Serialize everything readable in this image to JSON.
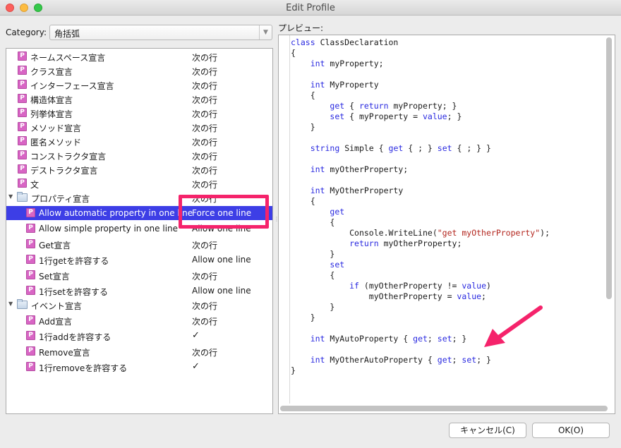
{
  "window": {
    "title": "Edit Profile"
  },
  "category": {
    "label": "Category:",
    "value": "角括弧"
  },
  "tree": {
    "rows": [
      {
        "icon": "p",
        "label": "ネームスペース宣言",
        "value": "次の行"
      },
      {
        "icon": "p",
        "label": "クラス宣言",
        "value": "次の行"
      },
      {
        "icon": "p",
        "label": "インターフェース宣言",
        "value": "次の行"
      },
      {
        "icon": "p",
        "label": "構造体宣言",
        "value": "次の行"
      },
      {
        "icon": "p",
        "label": "列挙体宣言",
        "value": "次の行"
      },
      {
        "icon": "p",
        "label": "メソッド宣言",
        "value": "次の行"
      },
      {
        "icon": "p",
        "label": "匿名メソッド",
        "value": "次の行"
      },
      {
        "icon": "p",
        "label": "コンストラクタ宣言",
        "value": "次の行"
      },
      {
        "icon": "p",
        "label": "デストラクタ宣言",
        "value": "次の行"
      },
      {
        "icon": "p",
        "label": "文",
        "value": "次の行"
      },
      {
        "icon": "folder",
        "label": "プロパティ宣言",
        "value": "次の行"
      },
      {
        "icon": "p",
        "label": "Allow automatic property in one line",
        "value": "Force one line"
      },
      {
        "icon": "p",
        "label": "Allow simple property in one line",
        "value": "Allow one line"
      },
      {
        "icon": "p",
        "label": "Get宣言",
        "value": "次の行"
      },
      {
        "icon": "p",
        "label": "1行getを許容する",
        "value": "Allow one line"
      },
      {
        "icon": "p",
        "label": "Set宣言",
        "value": "次の行"
      },
      {
        "icon": "p",
        "label": "1行setを許容する",
        "value": "Allow one line"
      },
      {
        "icon": "folder",
        "label": "イベント宣言",
        "value": "次の行"
      },
      {
        "icon": "p",
        "label": "Add宣言",
        "value": "次の行"
      },
      {
        "icon": "p",
        "label": "1行addを許容する",
        "value": ""
      },
      {
        "icon": "p",
        "label": "Remove宣言",
        "value": "次の行"
      },
      {
        "icon": "p",
        "label": "1行removeを許容する",
        "value": ""
      }
    ],
    "checkmark": "✓"
  },
  "preview": {
    "label": "プレビュー:",
    "code": [
      "class ClassDeclaration",
      "{",
      "    int myProperty;",
      "",
      "    int MyProperty",
      "    {",
      "        get { return myProperty; }",
      "        set { myProperty = value; }",
      "    }",
      "",
      "    string Simple { get { ; } set { ; } }",
      "",
      "    int myOtherProperty;",
      "",
      "    int MyOtherProperty",
      "    {",
      "        get",
      "        {",
      "            Console.WriteLine(\"get myOtherProperty\");",
      "            return myOtherProperty;",
      "        }",
      "        set",
      "        {",
      "            if (myOtherProperty != value)",
      "                myOtherProperty = value;",
      "        }",
      "    }",
      "",
      "    int MyAutoProperty { get; set; }",
      "",
      "    int MyOtherAutoProperty { get; set; }",
      "}"
    ]
  },
  "buttons": {
    "cancel": "キャンセル(C)",
    "ok": "OK(O)"
  },
  "colors": {
    "selection": "#3d3ee6",
    "highlight": "#f5236b",
    "keyword": "#2a2ae0",
    "string": "#b3261e",
    "p_icon": "#d865c4"
  }
}
